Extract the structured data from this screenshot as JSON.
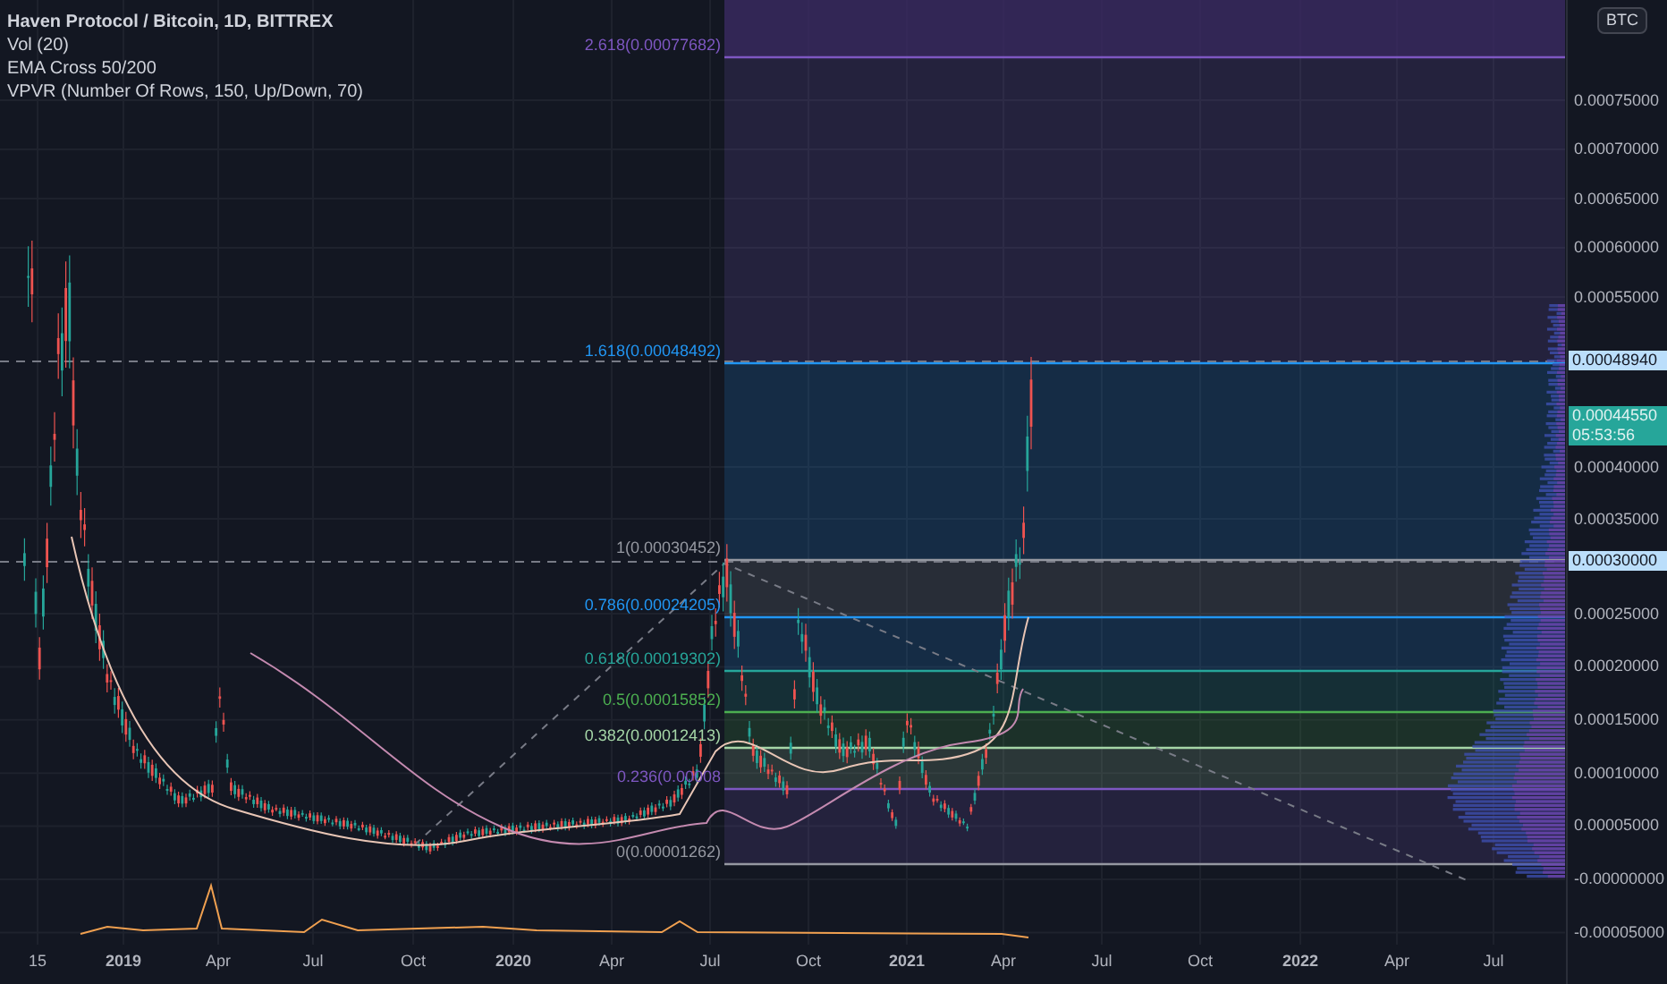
{
  "legend": {
    "title": "Haven Protocol / Bitcoin, 1D, BITTREX",
    "indicators": [
      "Vol (20)",
      "EMA Cross 50/200",
      "VPVR (Number Of Rows, 150, Up/Down, 70)"
    ]
  },
  "price_axis": {
    "unit": "BTC",
    "labels": [
      "0.00075000",
      "0.00070000",
      "0.00065000",
      "0.00060000",
      "0.00055000",
      "0.00040000",
      "0.00035000",
      "0.00025000",
      "0.00020000",
      "0.00015000",
      "0.00010000",
      "0.00005000",
      "-0.00000000",
      "-0.00005000"
    ]
  },
  "price_badges": [
    {
      "kind": "level",
      "value": "0.00048940"
    },
    {
      "kind": "last_price",
      "value": "0.00044550",
      "countdown": "05:53:56"
    },
    {
      "kind": "level",
      "value": "0.00030000"
    }
  ],
  "fib_levels": [
    {
      "label": "2.618(0.00077682)",
      "color": "#7e57c2"
    },
    {
      "label": "1.618(0.00048492)",
      "color": "#2196f3"
    },
    {
      "label": "1(0.00030452)",
      "color": "#9598a1"
    },
    {
      "label": "0.786(0.00024205)",
      "color": "#2196f3"
    },
    {
      "label": "0.618(0.00019302)",
      "color": "#26a69a"
    },
    {
      "label": "0.5(0.00015852)",
      "color": "#4caf50"
    },
    {
      "label": "0.382(0.00012413)",
      "color": "#a5d6a7"
    },
    {
      "label": "0.236(0.00008",
      "color": "#7e57c2"
    },
    {
      "label": "0(0.00001262)",
      "color": "#9598a1"
    }
  ],
  "time_axis": {
    "labels": [
      "15",
      "2019",
      "Apr",
      "Jul",
      "Oct",
      "2020",
      "Apr",
      "Jul",
      "Oct",
      "2021",
      "Apr",
      "Jul",
      "Oct",
      "2022",
      "Apr",
      "Jul"
    ]
  }
}
